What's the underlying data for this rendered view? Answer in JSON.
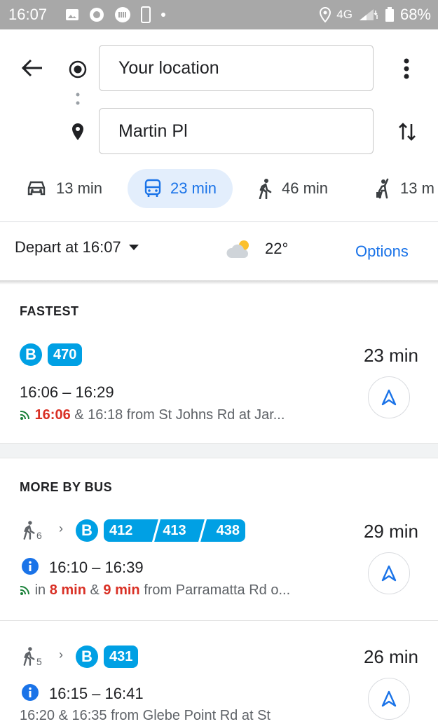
{
  "status_bar": {
    "time": "16:07",
    "network": "4G",
    "battery": "68%"
  },
  "search": {
    "origin": "Your location",
    "destination": "Martin Pl"
  },
  "modes": [
    {
      "name": "car",
      "label": "13 min",
      "selected": false
    },
    {
      "name": "transit",
      "label": "23 min",
      "selected": true
    },
    {
      "name": "walk",
      "label": "46 min",
      "selected": false
    },
    {
      "name": "ride",
      "label": "13 m",
      "selected": false
    }
  ],
  "filter": {
    "depart": "Depart at 16:07",
    "temperature": "22°",
    "options": "Options"
  },
  "fastest": {
    "title": "FASTEST",
    "badge": "B",
    "routes": [
      "470"
    ],
    "duration": "23 min",
    "times": "16:06 – 16:29",
    "realtime": "16:06",
    "amp": " & ",
    "rest": "16:18 from St Johns Rd at Jar..."
  },
  "more_by_bus": {
    "title": "MORE BY BUS",
    "items": [
      {
        "walk_minutes": "6",
        "badge": "B",
        "routes": [
          "412",
          "413",
          "438"
        ],
        "duration": "29 min",
        "times": "16:10 – 16:39",
        "pre": "in ",
        "rt1": "8 min",
        "amp": " & ",
        "rt2": "9 min",
        "rest": " from Parramatta Rd o..."
      },
      {
        "walk_minutes": "5",
        "badge": "B",
        "routes": [
          "431"
        ],
        "duration": "26 min",
        "times": "16:15 – 16:41",
        "rest": "16:20 & 16:35 from Glebe Point Rd at St"
      }
    ]
  },
  "colors": {
    "accent": "#1a73e8",
    "bus": "#00a0e4",
    "realtime": "#d93025",
    "live": "#188038"
  }
}
